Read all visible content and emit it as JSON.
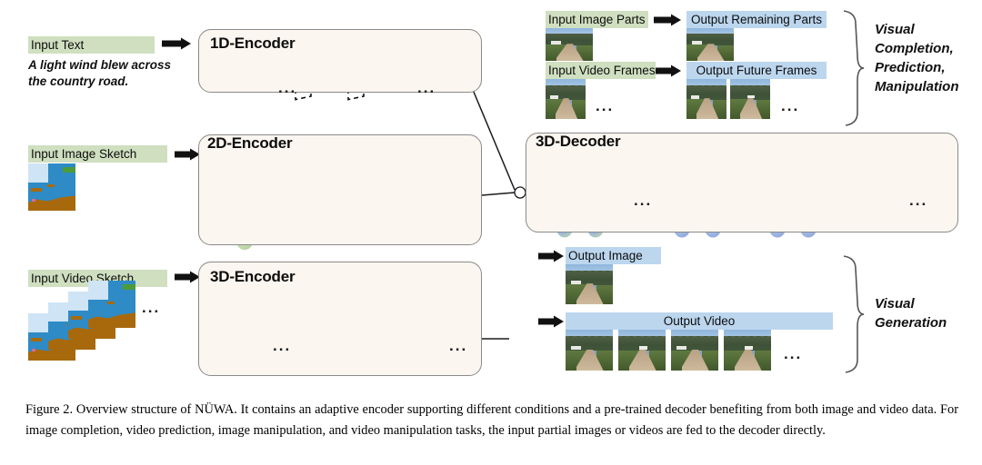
{
  "figure": {
    "title": "Figure 2. Overview structure of NÜWA.",
    "caption": "Figure 2. Overview structure of NÜWA. It contains an adaptive encoder supporting different conditions and a pre-trained decoder benefiting from both image and video data.  For image completion, video prediction, image manipulation, and video manipulation tasks, the input partial images or videos are fed to the decoder directly."
  },
  "encoders": [
    {
      "id": "1d-encoder",
      "title": "1D-Encoder",
      "input_label": "Input Text",
      "input_caption": "A light wind blew across\nthe country road.",
      "ellipsis": "..."
    },
    {
      "id": "2d-encoder",
      "title": "2D-Encoder",
      "input_label": "Input Image Sketch",
      "ellipsis": "..."
    },
    {
      "id": "3d-encoder",
      "title": "3D-Encoder",
      "input_label": "Input Video Sketch",
      "ellipsis": "..."
    }
  ],
  "decoder": {
    "id": "3d-decoder",
    "title": "3D-Decoder",
    "ellipsis": "..."
  },
  "io_pairs": [
    {
      "input_label": "Input Image Parts",
      "output_label": "Output Remaining Parts"
    },
    {
      "input_label": "Input Video Frames",
      "output_label": "Output Future Frames"
    }
  ],
  "outputs": [
    {
      "label": "Output Image"
    },
    {
      "label": "Output Video"
    }
  ],
  "side_notes": [
    {
      "id": "note-top",
      "text": "Visual\nCompletion,\nPrediction,\nManipulation"
    },
    {
      "id": "note-bottom",
      "text": "Visual\nGeneration"
    }
  ],
  "ellipsis": "...",
  "colors": {
    "input_label_bg": "#cfdfc0",
    "output_label_bg": "#bcd6ee",
    "panel_bg": "#fcf6f0",
    "panel_border": "#8a8a8a",
    "encoder_node": "#bcd9a5",
    "decoder_node": "#9ab4e0",
    "highlight_node": "#e8751a",
    "line": "#1a1a1a"
  }
}
